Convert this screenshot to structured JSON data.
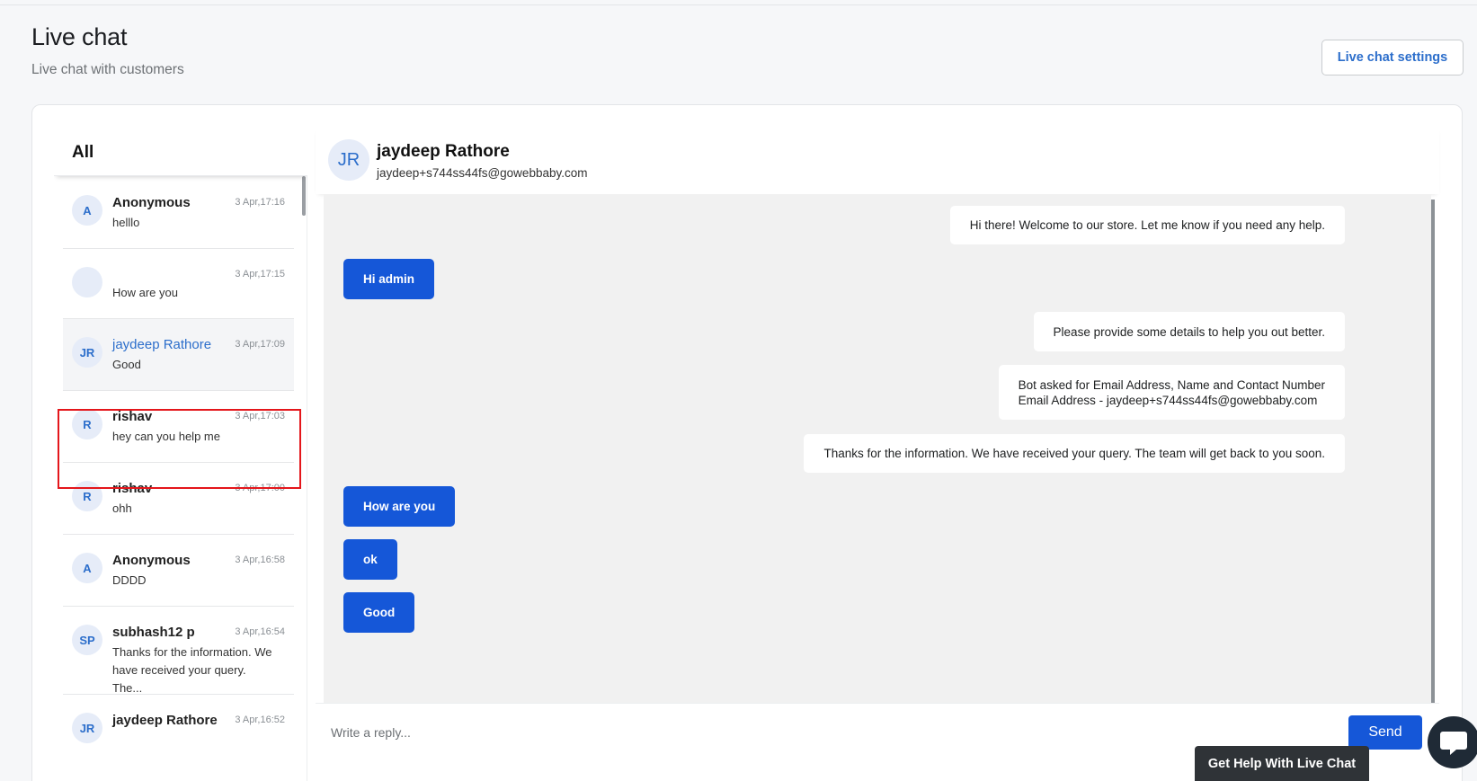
{
  "page": {
    "title": "Live chat",
    "subtitle": "Live chat with customers",
    "settings_button": "Live chat settings"
  },
  "list": {
    "header": "All",
    "conversations": [
      {
        "initials": "A",
        "name": "Anonymous",
        "time": "3 Apr,17:16",
        "preview": "helllo",
        "active": false
      },
      {
        "initials": "",
        "name": "",
        "time": "3 Apr,17:15",
        "preview": "How are you",
        "active": false
      },
      {
        "initials": "JR",
        "name": "jaydeep Rathore",
        "time": "3 Apr,17:09",
        "preview": "Good",
        "active": true
      },
      {
        "initials": "R",
        "name": "rishav",
        "time": "3 Apr,17:03",
        "preview": "hey can you help me",
        "active": false
      },
      {
        "initials": "R",
        "name": "rishav",
        "time": "3 Apr,17:00",
        "preview": "ohh",
        "active": false
      },
      {
        "initials": "A",
        "name": "Anonymous",
        "time": "3 Apr,16:58",
        "preview": "DDDD",
        "active": false
      },
      {
        "initials": "SP",
        "name": "subhash12 p",
        "time": "3 Apr,16:54",
        "preview": "Thanks for the information. We have received your query. The...",
        "active": false
      },
      {
        "initials": "JR",
        "name": "jaydeep Rathore",
        "time": "3 Apr,16:52",
        "preview": "",
        "active": false
      }
    ]
  },
  "chat": {
    "initials": "JR",
    "name": "jaydeep Rathore",
    "email": "jaydeep+s744ss44fs@gowebbaby.com",
    "messages": [
      {
        "from": "bot",
        "text": "Hi there! Welcome to our store. Let me know if you need any help."
      },
      {
        "from": "user",
        "text": "Hi admin"
      },
      {
        "from": "bot",
        "text": "Please provide some details to help you out better."
      },
      {
        "from": "bot",
        "line1": "Bot asked for Email Address, Name and Contact Number",
        "line2": "Email Address - jaydeep+s744ss44fs@gowebbaby.com"
      },
      {
        "from": "bot",
        "text": "Thanks for the information. We have received your query. The team will get back to you soon."
      },
      {
        "from": "user",
        "text": "How are you"
      },
      {
        "from": "user",
        "text": "ok"
      },
      {
        "from": "user",
        "text": "Good"
      }
    ]
  },
  "reply": {
    "placeholder": "Write a reply...",
    "send_label": "Send"
  },
  "help_button": "Get Help With Live Chat",
  "colors": {
    "accent": "#1557d8",
    "link": "#2c6ecb",
    "highlight": "#e4161b"
  }
}
